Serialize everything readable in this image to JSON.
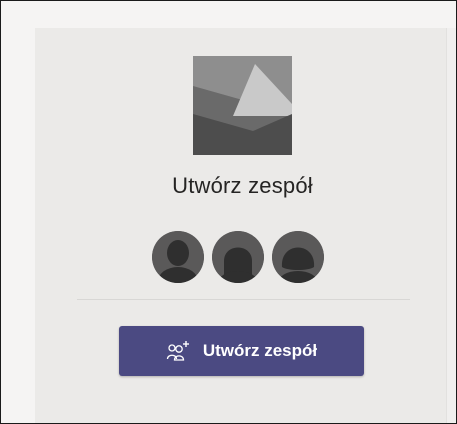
{
  "team_card": {
    "title": "Utwórz zespół",
    "button_label": "Utwórz zespół",
    "button_icon": "add-team-icon",
    "image_icon": "image-placeholder-icon",
    "member_icons": [
      "person-avatar-icon",
      "person-avatar-icon",
      "person-avatar-icon"
    ]
  },
  "colors": {
    "button": "#4b4a82",
    "card": "#ebeae8",
    "avatar": "#575656"
  }
}
